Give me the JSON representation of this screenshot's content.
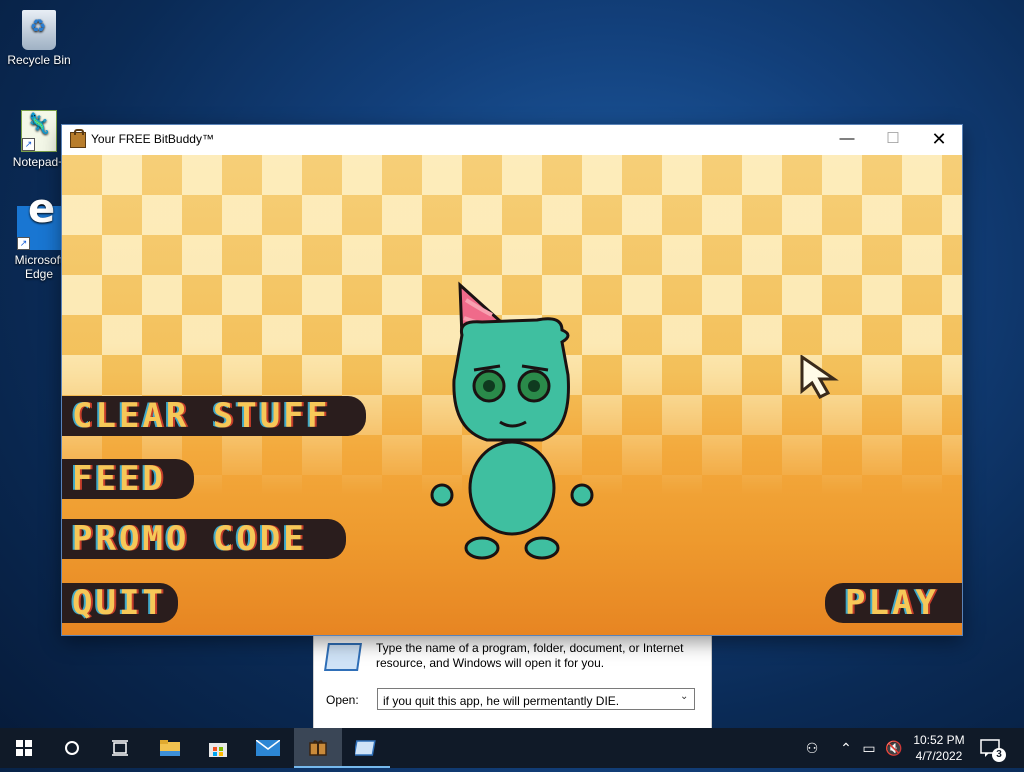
{
  "desktop": {
    "icons": [
      {
        "label": "Recycle Bin",
        "icon": "recycle-bin-icon"
      },
      {
        "label": "Notepad+",
        "icon": "notepad-plus-plus-icon"
      },
      {
        "label": "Microsoft Edge",
        "icon": "edge-icon"
      }
    ]
  },
  "window": {
    "title": "Your FREE BitBuddy™",
    "controls": {
      "minimize": "—",
      "maximize": "☐",
      "close": "✕"
    }
  },
  "game": {
    "menu": {
      "clear_stuff": "CLEAR STUFF",
      "feed": "FEED",
      "promo_code": "PROMO CODE",
      "quit": "QUIT",
      "play": "PLAY"
    },
    "colors": {
      "accent_text": "#f6c858",
      "button_bg": "#2a1d1d",
      "buddy": "#3fbfa0",
      "hat": "#f06a8a"
    }
  },
  "run_dialog": {
    "description": "Type the name of a program, folder, document, or Internet resource, and Windows will open it for you.",
    "open_label": "Open:",
    "open_value": "if you quit this app, he will permentantly DIE."
  },
  "taskbar": {
    "items": [
      "start-icon",
      "search-icon",
      "task-view-icon",
      "file-explorer-icon",
      "store-icon",
      "mail-icon",
      "bitbuddy-icon",
      "run-icon"
    ],
    "clock_time": "10:52 PM",
    "clock_date": "4/7/2022",
    "notification_count": "3"
  }
}
